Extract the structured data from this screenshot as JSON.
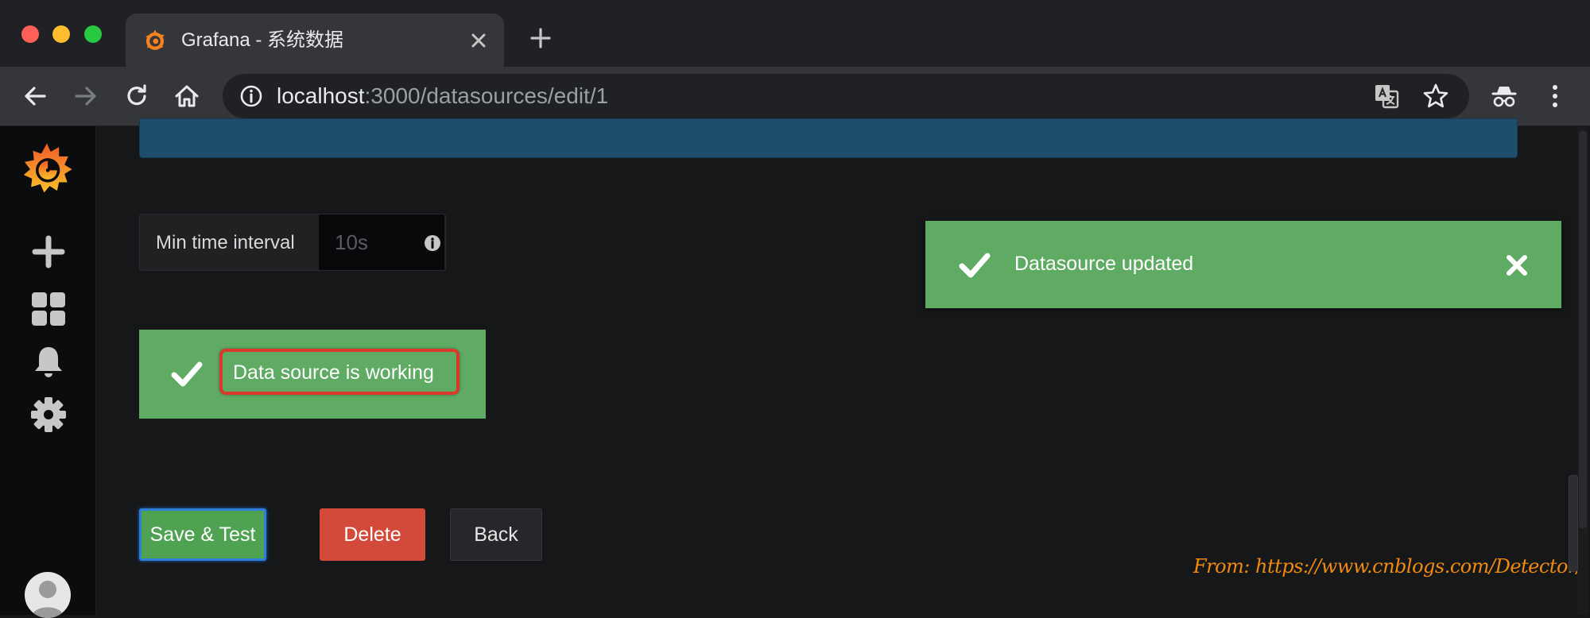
{
  "browser": {
    "tab": {
      "title": "Grafana - 系统数据"
    },
    "address": {
      "host": "localhost",
      "rest": ":3000/datasources/edit/1"
    }
  },
  "settings": {
    "min_time_interval": {
      "label": "Min time interval",
      "placeholder": "10s"
    }
  },
  "status": {
    "message": "Data source is working"
  },
  "toast": {
    "message": "Datasource updated"
  },
  "buttons": {
    "save_test": "Save & Test",
    "delete": "Delete",
    "back": "Back"
  },
  "watermark": "From: https://www.cnblogs.com/Detector/",
  "colors": {
    "success": "#5fab63",
    "danger": "#d44a3a",
    "primary_outline": "#2f7ed8",
    "grafana_orange": "#f5821f",
    "annotation_red": "#d9392a"
  },
  "icons": {
    "tab": [
      "grafana-logo-icon",
      "close-icon",
      "plus-icon"
    ],
    "toolbar": [
      "back-arrow-icon",
      "forward-arrow-icon",
      "reload-icon",
      "home-icon",
      "info-icon",
      "translate-icon",
      "star-icon",
      "incognito-icon",
      "more-vert-icon"
    ],
    "sidebar": [
      "grafana-logo-icon",
      "plus-icon",
      "dashboards-icon",
      "bell-icon",
      "gear-icon",
      "avatar"
    ]
  }
}
